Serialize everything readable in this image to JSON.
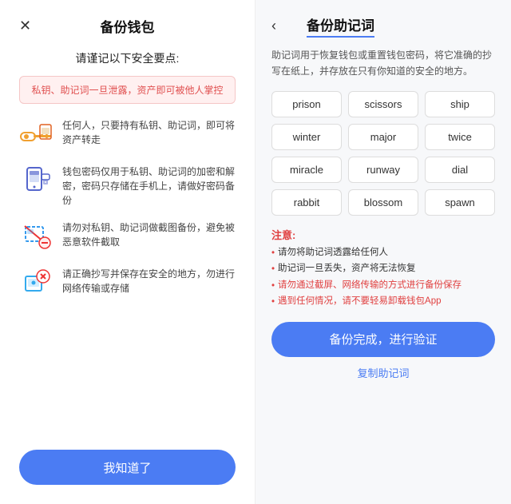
{
  "left": {
    "close_icon": "✕",
    "title": "备份钱包",
    "subtitle": "请谨记以下安全要点:",
    "warning": "私钥、助记词一旦泄露，资产即可被他人掌控",
    "safety_items": [
      {
        "icon_type": "key",
        "text": "任何人，只要持有私钥、助记词，即可将资产转走"
      },
      {
        "icon_type": "lock",
        "text": "钱包密码仅用于私钥、助记词的加密和解密，密码只存储在手机上，请做好密码备份"
      },
      {
        "icon_type": "scan",
        "text": "请勿对私钥、助记词做截图备份，避免被恶意软件截取"
      },
      {
        "icon_type": "cloud",
        "text": "请正确抄写并保存在安全的地方，勿进行网络传输或存储"
      }
    ],
    "button_label": "我知道了"
  },
  "right": {
    "back_icon": "‹",
    "title": "备份助记词",
    "description": "助记词用于恢复钱包或重置钱包密码，将它准确的抄写在纸上，并存放在只有你知道的安全的地方。",
    "words": [
      "prison",
      "scissors",
      "ship",
      "winter",
      "major",
      "twice",
      "miracle",
      "runway",
      "dial",
      "rabbit",
      "blossom",
      "spawn"
    ],
    "notes_title": "注意:",
    "notes": [
      "请勿将助记词透露给任何人",
      "助记词一旦丢失，资产将无法恢复",
      "请勿通过截屏、网络传输的方式进行备份保存",
      "遇到任何情况，请不要轻易卸载钱包App"
    ],
    "notes_red_indices": [
      2,
      3
    ],
    "button_label": "备份完成，进行验证",
    "copy_label": "复制助记词"
  }
}
